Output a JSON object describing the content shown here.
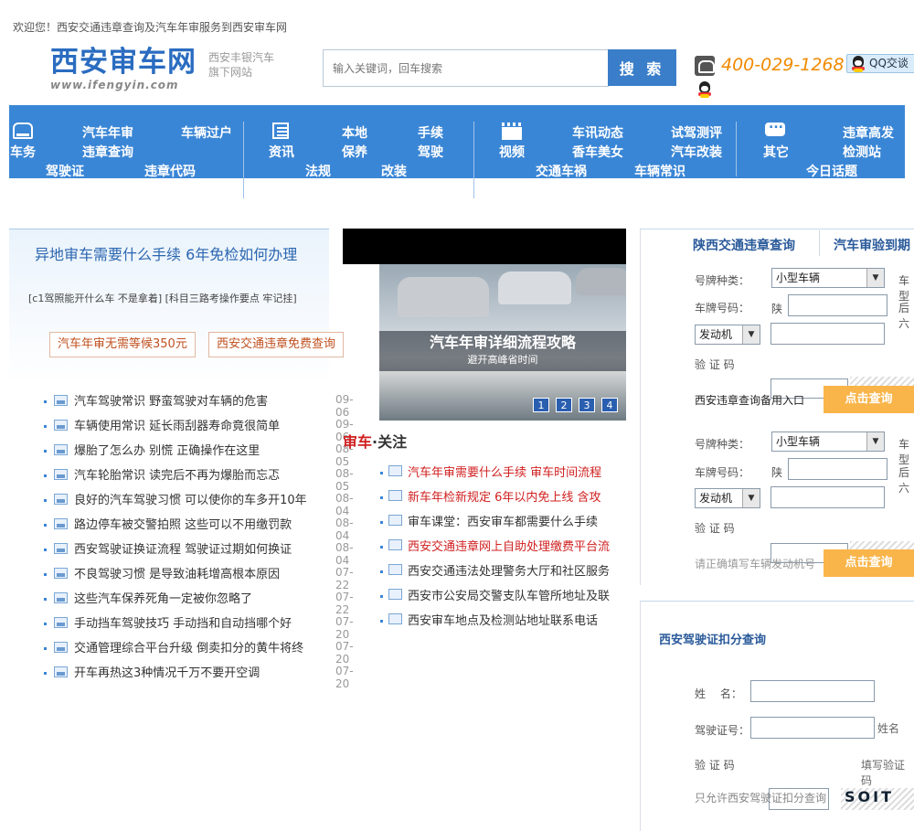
{
  "header": {
    "welcome": "欢迎您！西安交通违章查询及汽车年审服务到西安审车网",
    "logo_title": "西安审车网",
    "logo_url": "www.ifengyin.com",
    "logo_sub": "西安丰银汽车旗下网站",
    "search_placeholder": "输入关键词，回车搜索",
    "search_btn": "搜 索",
    "phone": "400-029-1268",
    "qq": "QQ交谈"
  },
  "nav": {
    "col1": [
      "车务",
      "汽车年审",
      "车辆过户",
      "违章查询",
      "驾驶证",
      "违章代码"
    ],
    "col2": [
      "资讯",
      "本地",
      "手续",
      "保养",
      "驾驶",
      "法规",
      "改装"
    ],
    "col3": [
      "视频",
      "车讯动态",
      "试驾测评",
      "香车美女",
      "汽车改装",
      "交通车祸",
      "车辆常识"
    ],
    "col4": [
      "其它",
      "违章高发",
      "检测站",
      "今日话题"
    ]
  },
  "left": {
    "title": "异地审车需要什么手续 6年免检如何办理",
    "sub": "[c1驾照能开什么车  不是拿着] [科目三路考操作要点  牢记挂]",
    "tag1": "汽车年审无需等候350元",
    "tag2": "西安交通违章免费查询",
    "news": [
      {
        "t": "汽车驾驶常识  野蛮驾驶对车辆的危害",
        "d": "09-06"
      },
      {
        "t": "车辆使用常识  延长雨刮器寿命竟很简单",
        "d": "09-06"
      },
      {
        "t": "爆胎了怎么办  别慌  正确操作在这里",
        "d": "08-05"
      },
      {
        "t": "汽车轮胎常识  读完后不再为爆胎而忘忑",
        "d": "08-05"
      },
      {
        "t": "良好的汽车驾驶习惯  可以使你的车多开10年",
        "d": "08-04"
      },
      {
        "t": "路边停车被交警拍照  这些可以不用缴罚款",
        "d": "08-04"
      },
      {
        "t": "西安驾驶证换证流程  驾驶证过期如何换证",
        "d": "08-04"
      },
      {
        "t": "不良驾驶习惯  是导致油耗增高根本原因",
        "d": "07-22"
      },
      {
        "t": "这些汽车保养死角一定被你忽略了",
        "d": "07-22"
      },
      {
        "t": "手动挡车驾驶技巧  手动挡和自动挡哪个好",
        "d": "07-20"
      },
      {
        "t": "交通管理综合平台升级  倒卖扣分的黄牛将终",
        "d": "07-20"
      },
      {
        "t": "开车再热这3种情况千万不要开空调",
        "d": "07-20"
      }
    ]
  },
  "center": {
    "photo_cap": "汽车年审详细流程攻略",
    "photo_sub": "避开高峰省时间",
    "pages": [
      "1",
      "2",
      "3",
      "4"
    ],
    "head_red": "审车",
    "head_rest": "·关注",
    "rows": [
      {
        "t": "汽车年审需要什么手续  审车时间流程",
        "red": true
      },
      {
        "t": "新车年检新规定  6年以内免上线  含攻",
        "red": true
      },
      {
        "t": "审车课堂：西安审车都需要什么手续",
        "red": false
      },
      {
        "t": "西安交通违章网上自助处理缴费平台流",
        "red": true
      },
      {
        "t": "西安交通违法处理警务大厅和社区服务",
        "red": false
      },
      {
        "t": "西安市公安局交警支队车管所地址及联",
        "red": false
      },
      {
        "t": "西安审车地点及检测站地址联系电话",
        "red": false
      }
    ]
  },
  "right": {
    "tab1": "陕西交通违章查询",
    "tab2": "汽车审验到期",
    "plate_type_label": "号牌种类：",
    "plate_type_value": "小型车辆",
    "plate_num_label": "车牌号码：",
    "plate_prefix": "陕",
    "engine_value": "发动机",
    "captcha_label": "验 证 码",
    "note1": "西安违章查询备用入口",
    "query_btn": "点击查询",
    "note2": "请正确填写车辆发动机号",
    "side_1": "车型",
    "side_2": "后六",
    "dl_title": "西安驾驶证扣分查询",
    "name_label": "姓　 名：",
    "license_label": "驾驶证号：",
    "dl_captcha": "验 证 码",
    "fill_captcha": "填写验证码",
    "fill_name": "姓名",
    "dl_note": "只允许西安驾驶证扣分查询",
    "captcha_text": "SOIT"
  }
}
